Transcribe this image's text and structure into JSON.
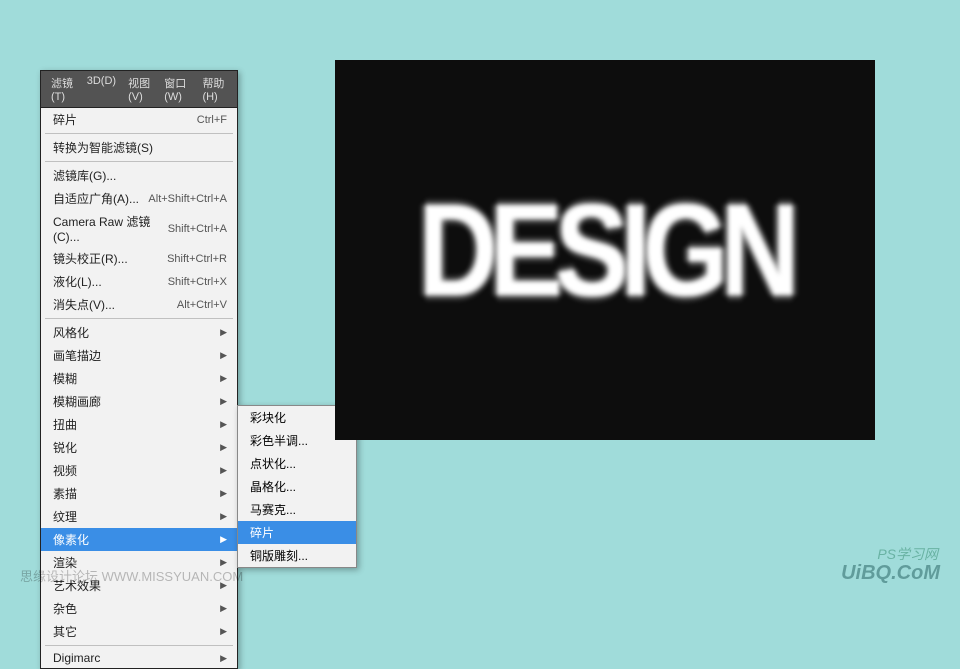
{
  "menubar": {
    "filter": "滤镜(T)",
    "threed": "3D(D)",
    "view": "视图(V)",
    "window": "窗口(W)",
    "help": "帮助(H)"
  },
  "menu": {
    "last_filter": "碎片",
    "last_filter_shortcut": "Ctrl+F",
    "convert_smart": "转换为智能滤镜(S)",
    "filter_gallery": "滤镜库(G)...",
    "adaptive_wide": "自适应广角(A)...",
    "adaptive_wide_shortcut": "Alt+Shift+Ctrl+A",
    "camera_raw": "Camera Raw 滤镜(C)...",
    "camera_raw_shortcut": "Shift+Ctrl+A",
    "lens_correction": "镜头校正(R)...",
    "lens_correction_shortcut": "Shift+Ctrl+R",
    "liquify": "液化(L)...",
    "liquify_shortcut": "Shift+Ctrl+X",
    "vanishing_point": "消失点(V)...",
    "vanishing_point_shortcut": "Alt+Ctrl+V",
    "stylize": "风格化",
    "brush_strokes": "画笔描边",
    "blur": "模糊",
    "blur_gallery": "模糊画廊",
    "distort": "扭曲",
    "sharpen": "锐化",
    "video": "视频",
    "sketch": "素描",
    "texture": "纹理",
    "pixelate": "像素化",
    "render": "渲染",
    "artistic": "艺术效果",
    "noise": "杂色",
    "other": "其它",
    "digimarc": "Digimarc"
  },
  "submenu": {
    "facet": "彩块化",
    "color_halftone": "彩色半调...",
    "pointillize": "点状化...",
    "crystallize": "晶格化...",
    "mosaic": "马赛克...",
    "fragment": "碎片",
    "mezzotint": "铜版雕刻..."
  },
  "canvas": {
    "text": "DESIGN"
  },
  "watermarks": {
    "left": "思缘设计论坛 WWW.MISSYUAN.COM",
    "right_top": "PS学习网",
    "right": "UiBQ.CoM"
  }
}
